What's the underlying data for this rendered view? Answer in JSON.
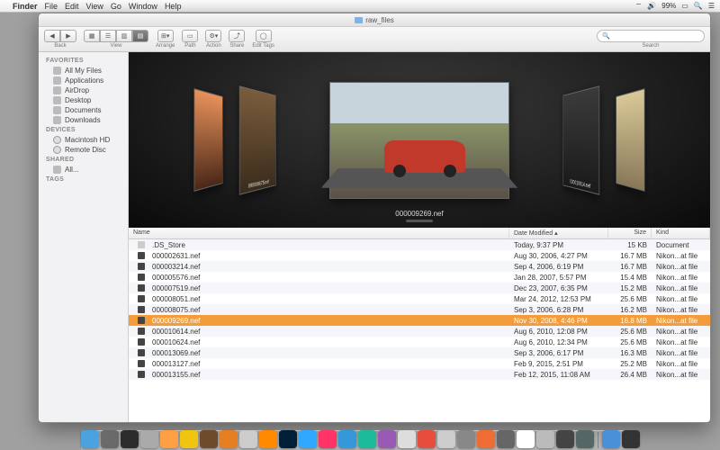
{
  "menubar": {
    "app": "Finder",
    "items": [
      "File",
      "Edit",
      "View",
      "Go",
      "Window",
      "Help"
    ],
    "battery": "99%",
    "clock": ""
  },
  "window": {
    "title": "raw_files"
  },
  "toolbar": {
    "back_label": "Back",
    "view_label": "View",
    "arrange_label": "Arrange",
    "path_label": "Path",
    "action_label": "Action",
    "share_label": "Share",
    "tags_label": "Edit Tags",
    "search_label": "Search",
    "search_placeholder": ""
  },
  "sidebar": {
    "favorites_label": "FAVORITES",
    "favorites": [
      "All My Files",
      "Applications",
      "AirDrop",
      "Desktop",
      "Documents",
      "Downloads"
    ],
    "devices_label": "DEVICES",
    "devices": [
      "Macintosh HD",
      "Remote Disc"
    ],
    "shared_label": "SHARED",
    "shared": [
      "All..."
    ],
    "tags_label": "TAGS"
  },
  "coverflow": {
    "center_name": "000009269.nef",
    "left1": "000008075.nef",
    "right1": "000010614.nef"
  },
  "list": {
    "headers": {
      "name": "Name",
      "date": "Date Modified",
      "size": "Size",
      "kind": "Kind"
    },
    "rows": [
      {
        "name": ".DS_Store",
        "date": "Today, 9:37 PM",
        "size": "15 KB",
        "kind": "Document",
        "ico": "doc"
      },
      {
        "name": "000002631.nef",
        "date": "Aug 30, 2006, 4:27 PM",
        "size": "16.7 MB",
        "kind": "Nikon...at file",
        "ico": "raw"
      },
      {
        "name": "000003214.nef",
        "date": "Sep 4, 2006, 6:19 PM",
        "size": "16.7 MB",
        "kind": "Nikon...at file",
        "ico": "raw"
      },
      {
        "name": "000005576.nef",
        "date": "Jan 28, 2007, 5:57 PM",
        "size": "15.4 MB",
        "kind": "Nikon...at file",
        "ico": "raw"
      },
      {
        "name": "000007519.nef",
        "date": "Dec 23, 2007, 6:35 PM",
        "size": "15.2 MB",
        "kind": "Nikon...at file",
        "ico": "raw"
      },
      {
        "name": "000008051.nef",
        "date": "Mar 24, 2012, 12:53 PM",
        "size": "25.6 MB",
        "kind": "Nikon...at file",
        "ico": "raw"
      },
      {
        "name": "000008075.nef",
        "date": "Sep 3, 2006, 6:28 PM",
        "size": "16.2 MB",
        "kind": "Nikon...at file",
        "ico": "raw"
      },
      {
        "name": "000009269.nef",
        "date": "Nov 30, 2008, 4:46 PM",
        "size": "16.8 MB",
        "kind": "Nikon...at file",
        "ico": "raw",
        "selected": true
      },
      {
        "name": "000010614.nef",
        "date": "Aug 6, 2010, 12:08 PM",
        "size": "25.6 MB",
        "kind": "Nikon...at file",
        "ico": "raw"
      },
      {
        "name": "000010624.nef",
        "date": "Aug 6, 2010, 12:34 PM",
        "size": "25.6 MB",
        "kind": "Nikon...at file",
        "ico": "raw"
      },
      {
        "name": "000013069.nef",
        "date": "Sep 3, 2006, 6:17 PM",
        "size": "16.3 MB",
        "kind": "Nikon...at file",
        "ico": "raw"
      },
      {
        "name": "000013127.nef",
        "date": "Feb 9, 2015, 2:51 PM",
        "size": "25.2 MB",
        "kind": "Nikon...at file",
        "ico": "raw"
      },
      {
        "name": "000013155.nef",
        "date": "Feb 12, 2015, 11:08 AM",
        "size": "26.4 MB",
        "kind": "Nikon...at file",
        "ico": "raw"
      }
    ]
  },
  "dock": {
    "colors": [
      "#4aa3df",
      "#6a6a6a",
      "#2c2c2c",
      "#aaa",
      "#ff9f43",
      "#f1c40f",
      "#6e4b2a",
      "#e67e22",
      "#ccc",
      "#ff8a00",
      "#001e36",
      "#31a8ff",
      "#ff3366",
      "#3498db",
      "#1abc9c",
      "#9b59b6",
      "#ddd",
      "#e74c3c",
      "#ccc",
      "#888",
      "#ef6c35",
      "#666",
      "#fff",
      "#bbb",
      "#444",
      "#566",
      "#4a90d9",
      "#333"
    ]
  }
}
